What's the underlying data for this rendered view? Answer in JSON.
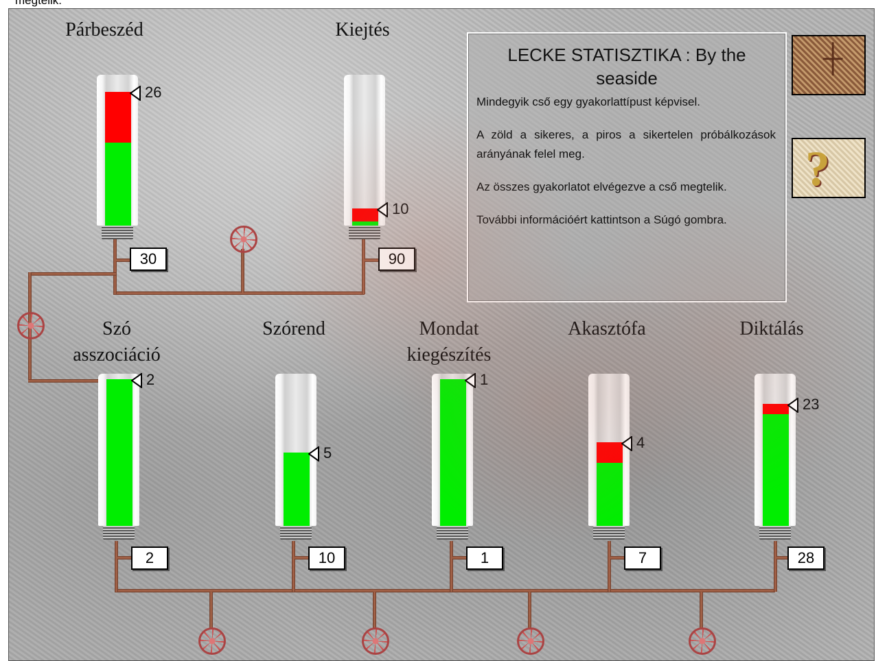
{
  "header": {
    "caption": "megtelik."
  },
  "info": {
    "title": "LECKE STATISZTIKA : By the\nseaside",
    "paragraphs": [
      "Mindegyik cső egy gyakorlattípust képvisel.",
      "A zöld a sikeres, a piros a sikertelen próbálkozások arányának felel meg.",
      "Az összes gyakorlatot elvégezve a cső megtelik.",
      "További információért kattintson a Súgó gombra."
    ]
  },
  "tubes": [
    {
      "label": "Párbeszéd",
      "flag_value": "26",
      "box_value": "30",
      "green_fraction": 0.57,
      "red_fraction": 0.35
    },
    {
      "label": "Kiejtés",
      "flag_value": "10",
      "box_value": "90",
      "green_fraction": 0.03,
      "red_fraction": 0.09
    },
    {
      "label": "Szó\nasszociáció",
      "flag_value": "2",
      "box_value": "2",
      "green_fraction": 1.0,
      "red_fraction": 0.0
    },
    {
      "label": "Szórend",
      "flag_value": "5",
      "box_value": "10",
      "green_fraction": 0.5,
      "red_fraction": 0.0
    },
    {
      "label": "Mondat\nkiegészítés",
      "flag_value": "1",
      "box_value": "1",
      "green_fraction": 1.0,
      "red_fraction": 0.0
    },
    {
      "label": "Akasztófa",
      "flag_value": "4",
      "box_value": "7",
      "green_fraction": 0.43,
      "red_fraction": 0.14
    },
    {
      "label": "Diktálás",
      "flag_value": "23",
      "box_value": "28",
      "green_fraction": 0.76,
      "red_fraction": 0.07
    }
  ],
  "icons": {
    "map_button": "map-icon",
    "help_button": "help-icon"
  },
  "colors": {
    "success": "#00ee00",
    "failure": "#ff0000"
  }
}
